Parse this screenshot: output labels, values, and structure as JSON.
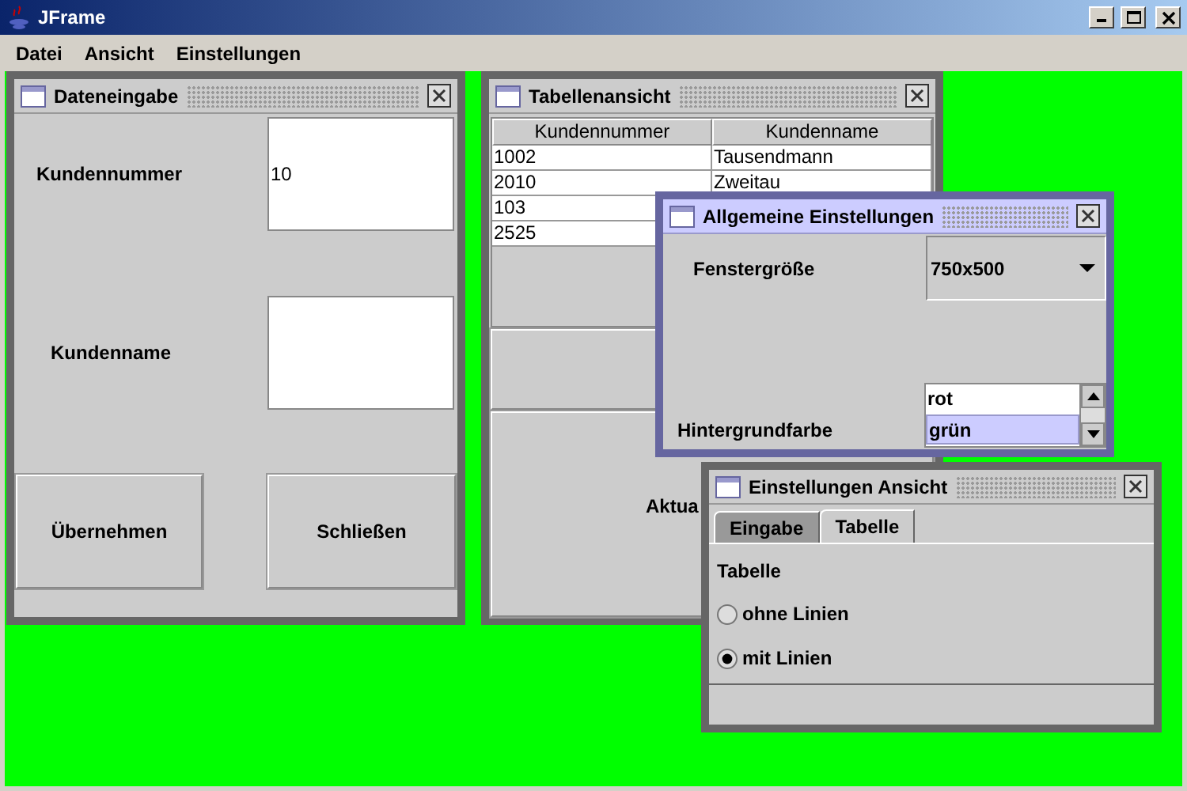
{
  "window": {
    "title": "JFrame"
  },
  "menu": [
    "Datei",
    "Ansicht",
    "Einstellungen"
  ],
  "frames": [
    {
      "kind": "input",
      "title": "Dateneingabe",
      "active": false,
      "fields": [
        {
          "label": "Kundennummer",
          "value": "10"
        },
        {
          "label": "Kundenname"
        }
      ],
      "buttons": [
        "Übernehmen",
        "Schließen"
      ]
    },
    {
      "kind": "table",
      "title": "Tabellenansicht",
      "active": false,
      "columns": [
        "Kundennummer",
        "Kundenname"
      ],
      "rows": [
        [
          "1002",
          "Tausendmann"
        ],
        [
          "2010",
          "Zweitau"
        ],
        [
          "103"
        ],
        [
          "2525"
        ]
      ],
      "button": "Aktua"
    },
    {
      "kind": "settings",
      "title": "Allgemeine Einstellungen",
      "active": true,
      "size_label": "Fenstergröße",
      "size_value": "750x500",
      "color_label": "Hintergrundfarbe",
      "colors": [
        {
          "label": "rot",
          "selected": false
        },
        {
          "label": "grün",
          "selected": true
        }
      ]
    },
    {
      "kind": "view",
      "title": "Einstellungen Ansicht",
      "active": false,
      "tabs": [
        {
          "label": "Eingabe",
          "selected": false
        },
        {
          "label": "Tabelle",
          "selected": true
        }
      ],
      "heading": "Tabelle",
      "options": [
        {
          "label": "ohne Linien",
          "selected": false
        },
        {
          "label": "mit Linien",
          "selected": true
        }
      ]
    }
  ]
}
